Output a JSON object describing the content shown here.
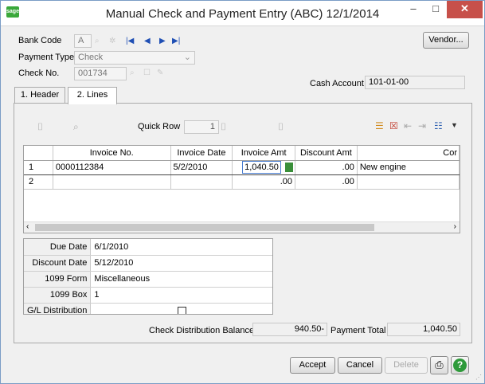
{
  "window": {
    "app_icon": "sage",
    "title": "Manual Check and Payment Entry (ABC) 12/1/2014",
    "controls": {
      "minimize": "–",
      "maximize": "□",
      "close": "✕"
    }
  },
  "header": {
    "bank_code_label": "Bank Code",
    "bank_code_value": "A",
    "payment_type_label": "Payment Type",
    "payment_type_value": "Check",
    "check_no_label": "Check No.",
    "check_no_value": "001734",
    "cash_account_label": "Cash Account",
    "cash_account_value": "101-01-00",
    "vendor_button": "Vendor..."
  },
  "tabs": [
    {
      "label": "1. Header",
      "active": false
    },
    {
      "label": "2. Lines",
      "active": true
    }
  ],
  "toolbar": {
    "quick_row_label": "Quick Row",
    "quick_row_value": "1"
  },
  "lines_grid": {
    "columns": [
      "",
      "Invoice No.",
      "Invoice Date",
      "Invoice Amt",
      "Discount Amt",
      "Cor"
    ],
    "rows": [
      {
        "row": "1",
        "invoice_no": "0000112384",
        "invoice_date": "5/2/2010",
        "invoice_amt": "1,040.50",
        "discount_amt": ".00",
        "comment": "New engine"
      },
      {
        "row": "2",
        "invoice_no": "",
        "invoice_date": "",
        "invoice_amt": ".00",
        "discount_amt": ".00",
        "comment": ""
      }
    ]
  },
  "details": [
    {
      "label": "Due Date",
      "value": "6/1/2010"
    },
    {
      "label": "Discount Date",
      "value": "5/12/2010"
    },
    {
      "label": "1099 Form",
      "value": "Miscellaneous"
    },
    {
      "label": "1099 Box",
      "value": "1"
    },
    {
      "label": "G/L Distribution",
      "value": ""
    }
  ],
  "totals": {
    "check_distribution_balance_label": "Check Distribution Balance",
    "check_distribution_balance_value": "940.50-",
    "payment_total_label": "Payment Total",
    "payment_total_value": "1,040.50"
  },
  "buttons": {
    "accept": "Accept",
    "cancel": "Cancel",
    "delete": "Delete"
  }
}
